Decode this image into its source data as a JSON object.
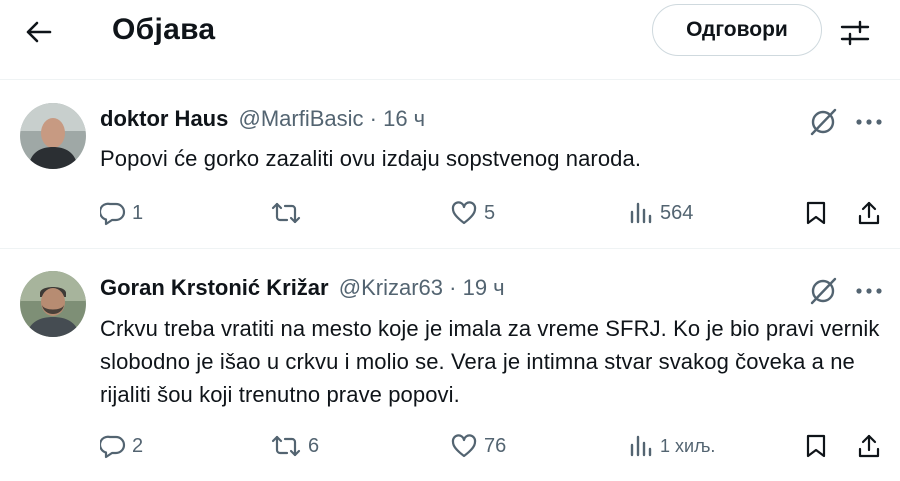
{
  "header": {
    "title": "Објава",
    "reply_label": "Одговори",
    "back_icon": "back-arrow-icon",
    "filter_icon": "filter-sliders-icon"
  },
  "posts": [
    {
      "name": "doktor Haus",
      "handle": "@MarfiBasic",
      "separator": "·",
      "time": "16 ч",
      "text": "Popovi će gorko zazaliti ovu izdaju sopstvenog naroda.",
      "replies": "1",
      "reposts": "",
      "likes": "5",
      "views": "564"
    },
    {
      "name": "Goran Krstonić Križar",
      "handle": "@Krizar63",
      "separator": "·",
      "time": "19 ч",
      "text": "Crkvu treba vratiti na mesto koje je imala za vreme SFRJ. Ko je bio pravi vernik slobodno je išao u crkvu i molio se. Vera je intimna stvar svakog čoveka a ne rijaliti šou koji trenutno prave popovi.",
      "replies": "2",
      "reposts": "6",
      "likes": "76",
      "views": "1 хиљ."
    }
  ],
  "colors": {
    "text": "#0f1419",
    "secondary": "#536471",
    "border": "#eff3f4"
  }
}
